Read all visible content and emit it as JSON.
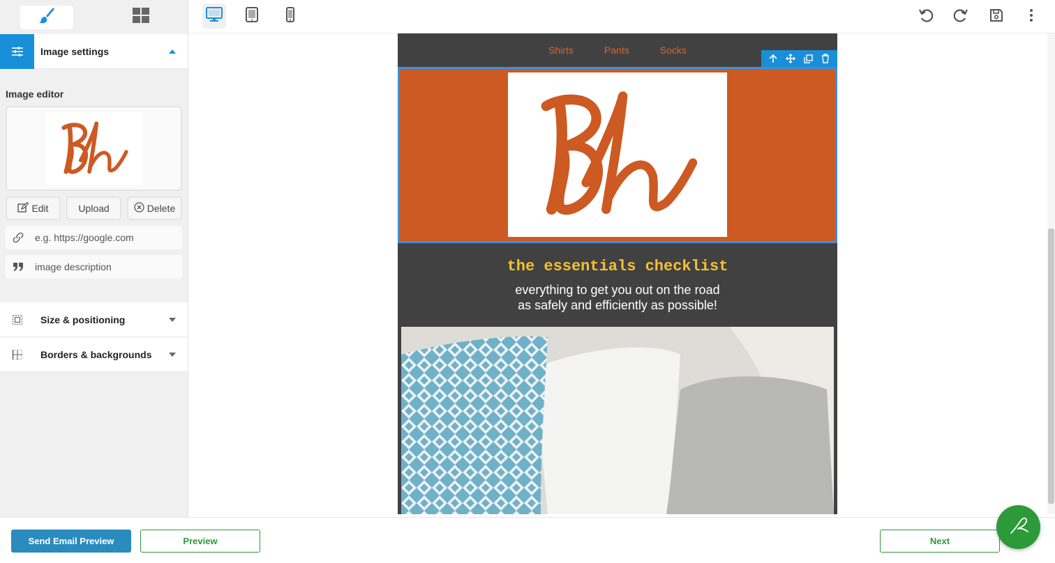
{
  "sidebar": {
    "tabs": [
      {
        "name": "style-tab",
        "icon": "paintbrush-icon"
      },
      {
        "name": "blocks-tab",
        "icon": "grid-icon"
      }
    ],
    "image_settings_label": "Image settings",
    "image_editor_label": "Image editor",
    "edit_label": "Edit",
    "upload_label": "Upload",
    "delete_label": "Delete",
    "link_placeholder": "e.g. https://google.com",
    "alt_placeholder": "image description",
    "size_label": "Size & positioning",
    "borders_label": "Borders & backgrounds"
  },
  "toolbar": {
    "devices": [
      "desktop-icon",
      "tablet-icon",
      "mobile-icon"
    ],
    "actions": [
      "undo-icon",
      "redo-icon",
      "save-icon",
      "more-vert-icon"
    ]
  },
  "email": {
    "nav": [
      "Shirts",
      "Pants",
      "Socks"
    ],
    "logo_text": "Bh",
    "title": "the essentials checklist",
    "subtitle_line1": "everything to get you out on the road",
    "subtitle_line2": "as safely and efficiently as possible!"
  },
  "footer": {
    "send_preview_label": "Send Email Preview",
    "preview_label": "Preview",
    "next_label": "Next"
  },
  "colors": {
    "accent_blue": "#1a8fd9",
    "brand_orange": "#cc5a22",
    "email_bg": "#414141",
    "title_yellow": "#f5c132",
    "green": "#2d9a3a"
  }
}
